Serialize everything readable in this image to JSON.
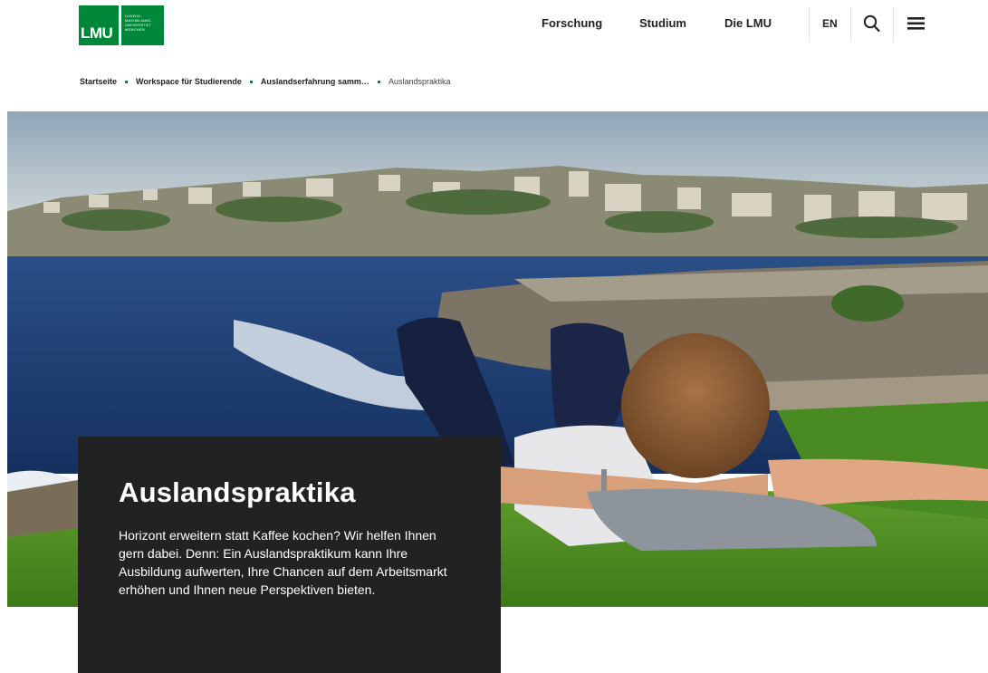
{
  "logo": {
    "mark": "LMU",
    "lines": [
      "LUDWIG-",
      "MAXIMILIANS-",
      "UNIVERSITÄT",
      "MÜNCHEN"
    ]
  },
  "nav": {
    "items": [
      "Forschung",
      "Studium",
      "Die LMU"
    ],
    "language": "EN"
  },
  "breadcrumb": [
    "Startseite",
    "Workspace für Studierende",
    "Auslandserfahrung samm…",
    "Auslandspraktika"
  ],
  "hero": {
    "title": "Auslandspraktika",
    "text": "Horizont erweitern statt Kaffee kochen? Wir helfen Ihnen gern dabei. Denn: Ein Auslandspraktikum kann Ihre Ausbildung aufwerten, Ihre Chancen auf dem Arbeitsmarkt erhöhen und Ihnen neue Perspektiven bieten."
  },
  "colors": {
    "brand": "#00883a",
    "intro_background": "#222222"
  },
  "icons": {
    "search": "search-icon",
    "menu": "hamburger-menu-icon"
  }
}
